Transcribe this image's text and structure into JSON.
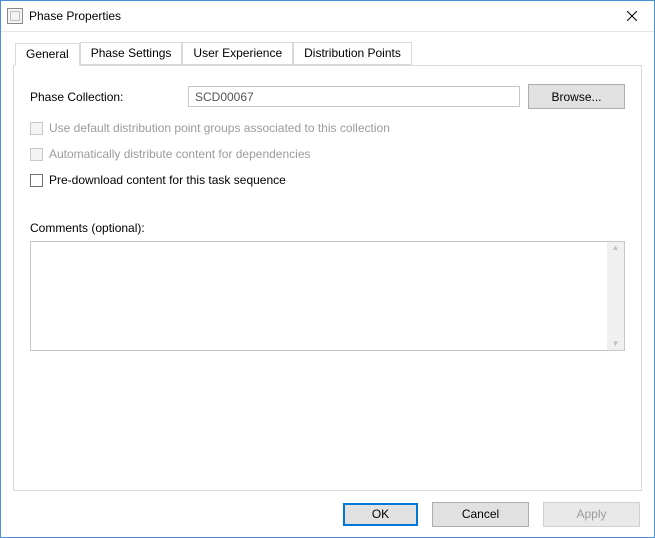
{
  "window": {
    "title": "Phase Properties"
  },
  "tabs": {
    "general": "General",
    "phase_settings": "Phase Settings",
    "user_experience": "User Experience",
    "distribution_points": "Distribution Points"
  },
  "general": {
    "phase_collection_label": "Phase Collection:",
    "phase_collection_value": "SCD00067",
    "browse_button": "Browse...",
    "cb_use_default_dp": "Use default distribution point groups associated to this collection",
    "cb_auto_distribute": "Automatically distribute content for dependencies",
    "cb_predownload": "Pre-download content for this task sequence",
    "comments_label": "Comments (optional):",
    "comments_value": ""
  },
  "footer": {
    "ok": "OK",
    "cancel": "Cancel",
    "apply": "Apply"
  }
}
